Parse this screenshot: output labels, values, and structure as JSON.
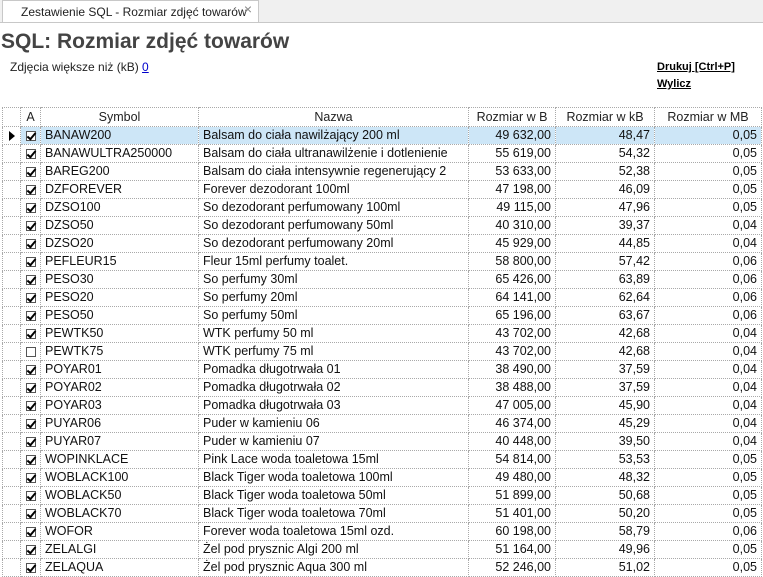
{
  "tab": {
    "title": "Zestawienie SQL - Rozmiar zdjęć towarów",
    "close": "×"
  },
  "page": {
    "title": "SQL: Rozmiar zdjęć towarów",
    "filter_label": "Zdjęcia większe niż (kB)",
    "filter_value": "0",
    "print_link": "Drukuj [Ctrl+P]",
    "calc_link": "Wylicz"
  },
  "table": {
    "columns": [
      "A",
      "Symbol",
      "Nazwa",
      "Rozmiar w B",
      "Rozmiar w kB",
      "Rozmiar w MB"
    ],
    "rows": [
      {
        "checked": true,
        "symbol": "BANAW200",
        "name": "Balsam do ciała nawilżający 200 ml",
        "b": "49 632,00",
        "kb": "48,47",
        "mb": "0,05",
        "selected": true
      },
      {
        "checked": true,
        "symbol": "BANAWULTRA250000",
        "name": "Balsam do ciała ultranawilżenie i dotlenienie",
        "b": "55 619,00",
        "kb": "54,32",
        "mb": "0,05"
      },
      {
        "checked": true,
        "symbol": "BAREG200",
        "name": "Balsam do ciała intensywnie regenerujący 2",
        "b": "53 633,00",
        "kb": "52,38",
        "mb": "0,05"
      },
      {
        "checked": true,
        "symbol": "DZFOREVER",
        "name": "Forever dezodorant 100ml",
        "b": "47 198,00",
        "kb": "46,09",
        "mb": "0,05"
      },
      {
        "checked": true,
        "symbol": "DZSO100",
        "name": "So dezodorant perfumowany 100ml",
        "b": "49 115,00",
        "kb": "47,96",
        "mb": "0,05"
      },
      {
        "checked": true,
        "symbol": "DZSO50",
        "name": "So dezodorant perfumowany 50ml",
        "b": "40 310,00",
        "kb": "39,37",
        "mb": "0,04"
      },
      {
        "checked": true,
        "symbol": "DZSO20",
        "name": "So dezodorant perfumowany 20ml",
        "b": "45 929,00",
        "kb": "44,85",
        "mb": "0,04"
      },
      {
        "checked": true,
        "symbol": "PEFLEUR15",
        "name": "Fleur 15ml perfumy toalet.",
        "b": "58 800,00",
        "kb": "57,42",
        "mb": "0,06"
      },
      {
        "checked": true,
        "symbol": "PESO30",
        "name": "So perfumy 30ml",
        "b": "65 426,00",
        "kb": "63,89",
        "mb": "0,06"
      },
      {
        "checked": true,
        "symbol": "PESO20",
        "name": "So perfumy 20ml",
        "b": "64 141,00",
        "kb": "62,64",
        "mb": "0,06"
      },
      {
        "checked": true,
        "symbol": "PESO50",
        "name": "So perfumy 50ml",
        "b": "65 196,00",
        "kb": "63,67",
        "mb": "0,06"
      },
      {
        "checked": true,
        "symbol": "PEWTK50",
        "name": "WTK perfumy 50 ml",
        "b": "43 702,00",
        "kb": "42,68",
        "mb": "0,04"
      },
      {
        "checked": false,
        "symbol": "PEWTK75",
        "name": "WTK perfumy 75 ml",
        "b": "43 702,00",
        "kb": "42,68",
        "mb": "0,04"
      },
      {
        "checked": true,
        "symbol": "POYAR01",
        "name": "Pomadka długotrwała 01",
        "b": "38 490,00",
        "kb": "37,59",
        "mb": "0,04"
      },
      {
        "checked": true,
        "symbol": "POYAR02",
        "name": "Pomadka długotrwała 02",
        "b": "38 488,00",
        "kb": "37,59",
        "mb": "0,04"
      },
      {
        "checked": true,
        "symbol": "POYAR03",
        "name": "Pomadka długotrwała 03",
        "b": "47 005,00",
        "kb": "45,90",
        "mb": "0,04"
      },
      {
        "checked": true,
        "symbol": "PUYAR06",
        "name": "Puder w kamieniu 06",
        "b": "46 374,00",
        "kb": "45,29",
        "mb": "0,04"
      },
      {
        "checked": true,
        "symbol": "PUYAR07",
        "name": "Puder w kamieniu 07",
        "b": "40 448,00",
        "kb": "39,50",
        "mb": "0,04"
      },
      {
        "checked": true,
        "symbol": "WOPINKLACE",
        "name": "Pink Lace woda toaletowa 15ml",
        "b": "54 814,00",
        "kb": "53,53",
        "mb": "0,05"
      },
      {
        "checked": true,
        "symbol": "WOBLACK100",
        "name": "Black Tiger woda toaletowa 100ml",
        "b": "49 480,00",
        "kb": "48,32",
        "mb": "0,05"
      },
      {
        "checked": true,
        "symbol": "WOBLACK50",
        "name": "Black Tiger woda toaletowa 50ml",
        "b": "51 899,00",
        "kb": "50,68",
        "mb": "0,05"
      },
      {
        "checked": true,
        "symbol": "WOBLACK70",
        "name": "Black Tiger woda toaletowa 70ml",
        "b": "51 401,00",
        "kb": "50,20",
        "mb": "0,05"
      },
      {
        "checked": true,
        "symbol": "WOFOR",
        "name": "Forever woda toaletowa 15ml ozd.",
        "b": "60 198,00",
        "kb": "58,79",
        "mb": "0,06"
      },
      {
        "checked": true,
        "symbol": "ZELALGI",
        "name": "Żel pod prysznic Algi 200 ml",
        "b": "51 164,00",
        "kb": "49,96",
        "mb": "0,05"
      },
      {
        "checked": true,
        "symbol": "ZELAQUA",
        "name": "Żel pod prysznic Aqua 300 ml",
        "b": "52 246,00",
        "kb": "51,02",
        "mb": "0,05"
      }
    ]
  },
  "colors": {
    "selected_row": "#cde6f7",
    "link": "#0000cc",
    "grid_border": "#a9a9a9"
  },
  "icons": {
    "row_indicator": "triangle-right",
    "checkbox": "checkmark"
  }
}
